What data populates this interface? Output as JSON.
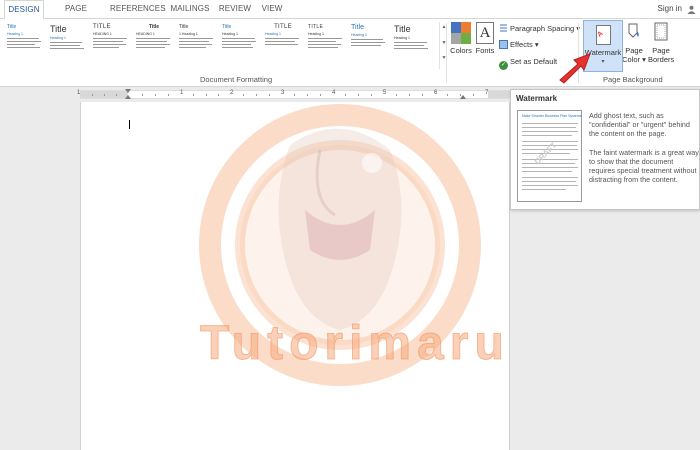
{
  "tabs": [
    {
      "label": "DESIGN",
      "active": true
    },
    {
      "label": "PAGE LAYOUT",
      "active": false
    },
    {
      "label": "REFERENCES",
      "active": false
    },
    {
      "label": "MAILINGS",
      "active": false
    },
    {
      "label": "REVIEW",
      "active": false
    },
    {
      "label": "VIEW",
      "active": false
    }
  ],
  "account": {
    "signin_label": "Sign in",
    "icon": "user-icon"
  },
  "ribbon": {
    "style_gallery": [
      {
        "title": "Title",
        "heading": "Heading 1"
      },
      {
        "title": "Title",
        "heading": "Heading 1"
      },
      {
        "title": "TITLE",
        "heading": "HEADING 1"
      },
      {
        "title": "Title",
        "heading": "HEADING 1"
      },
      {
        "title": "Title",
        "heading": "1 Heading 1"
      },
      {
        "title": "Title",
        "heading": "Heading 1"
      },
      {
        "title": "TITLE",
        "heading": "Heading 1"
      },
      {
        "title": "TITLE",
        "heading": "Heading 1"
      },
      {
        "title": "Title",
        "heading": "Heading 1"
      },
      {
        "title": "Title",
        "heading": "Heading 1"
      }
    ],
    "document_formatting_label": "Document Formatting",
    "colors_label": "Colors",
    "fonts_label": "Fonts",
    "fonts_glyph": "A",
    "paragraph_spacing_label": "Paragraph Spacing",
    "effects_label": "Effects",
    "set_as_default_label": "Set as Default",
    "watermark_label": "Watermark",
    "watermark_icon_text": "A",
    "page_color_label_1": "Page",
    "page_color_label_2": "Color",
    "page_borders_label_1": "Page",
    "page_borders_label_2": "Borders",
    "page_background_label": "Page Background",
    "colors": {
      "accent": "#2b579a",
      "watermark_highlight": "#cfe2f7",
      "arrow": "#e3342f"
    }
  },
  "ruler": {
    "marks": [
      "1",
      "1",
      "2",
      "3",
      "4",
      "5",
      "6",
      "7"
    ]
  },
  "watermark": {
    "text": "Tutorimaru",
    "color": "#f6ac7d"
  },
  "tooltip": {
    "title": "Watermark",
    "thumbnail_header": "Make Smarter Business Plan Systems",
    "thumbnail_stamp": "DRAFT",
    "description_1": "Add ghost text, such as \"confidential\" or \"urgent\" behind the content on the page.",
    "description_2": "The faint watermark is a great way to show that the document requires special treatment without distracting from the content."
  }
}
